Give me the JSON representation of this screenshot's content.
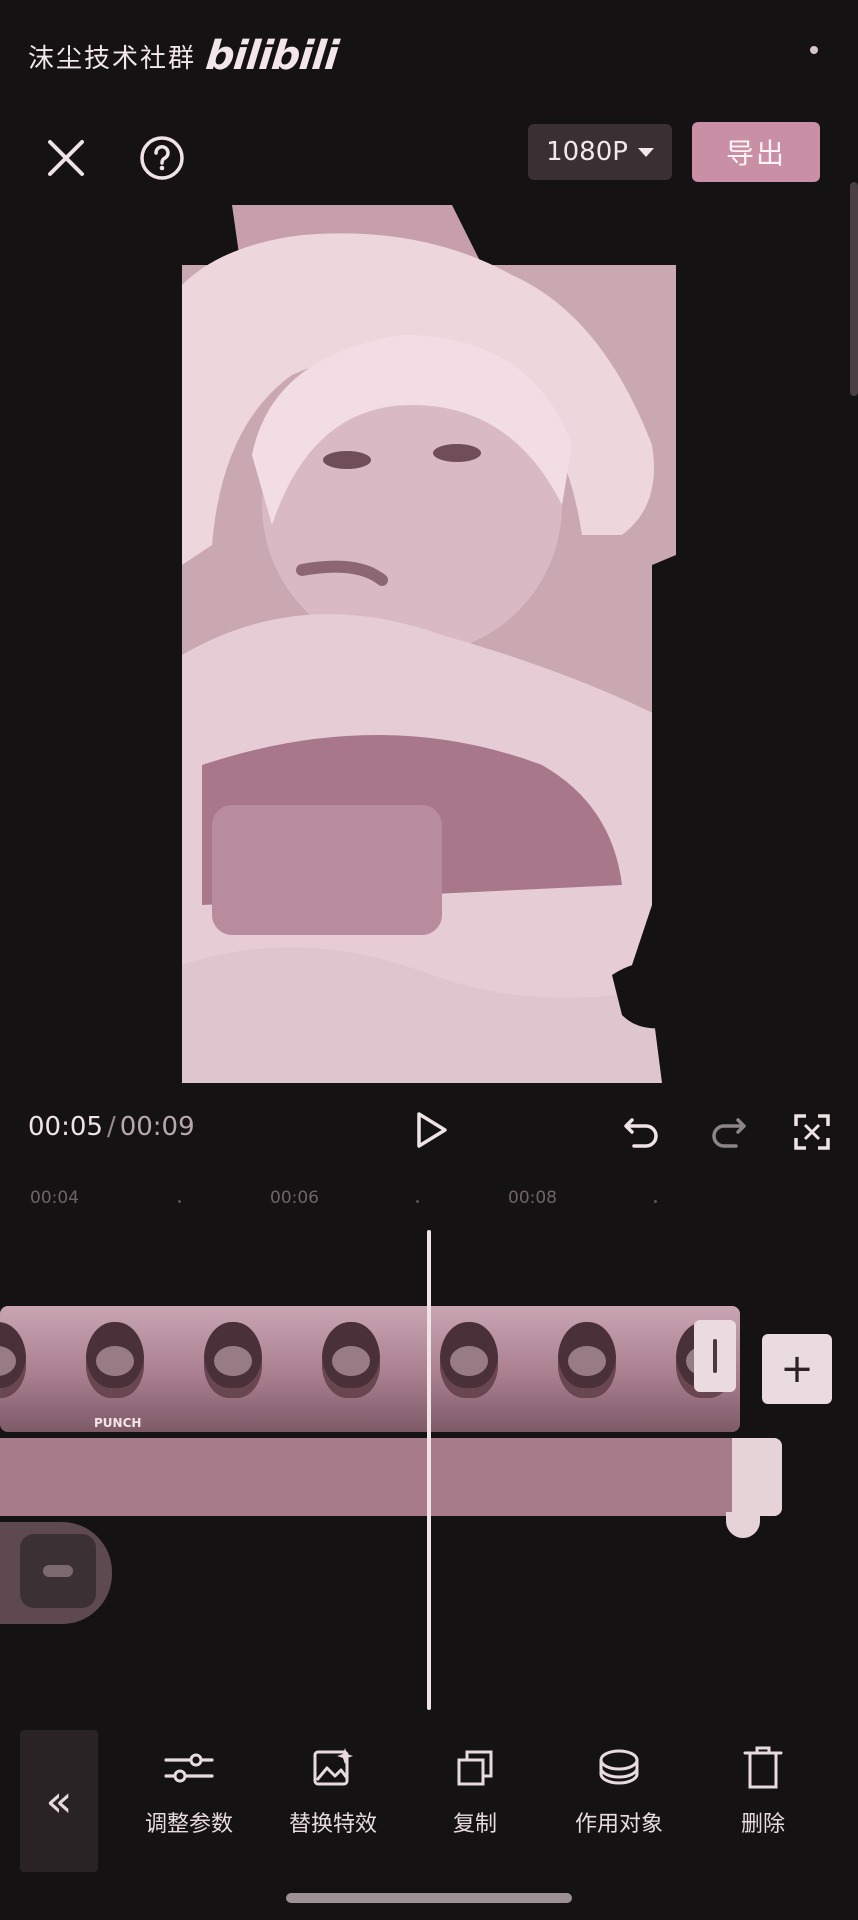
{
  "watermark": {
    "text": "沫尘技术社群",
    "logo": "bilibili"
  },
  "topbar": {
    "close_icon": "close-icon",
    "help_icon": "help-icon",
    "resolution": "1080P",
    "export_label": "导出"
  },
  "playback": {
    "current": "00:05",
    "separator": "/",
    "total": "00:09"
  },
  "ruler": {
    "ticks": [
      "00:04",
      "00:06",
      "00:08"
    ]
  },
  "video_track": {
    "frame_text": "PUNCH"
  },
  "toolbar": {
    "collapse": "«",
    "items": [
      {
        "label": "调整参数",
        "icon": "sliders-icon"
      },
      {
        "label": "替换特效",
        "icon": "replace-effect-icon"
      },
      {
        "label": "复制",
        "icon": "copy-icon"
      },
      {
        "label": "作用对象",
        "icon": "layers-icon"
      },
      {
        "label": "删除",
        "icon": "trash-icon"
      }
    ]
  },
  "colors": {
    "accent": "#c98fa4",
    "background": "#141213",
    "effect_track": "#a87b8b"
  }
}
